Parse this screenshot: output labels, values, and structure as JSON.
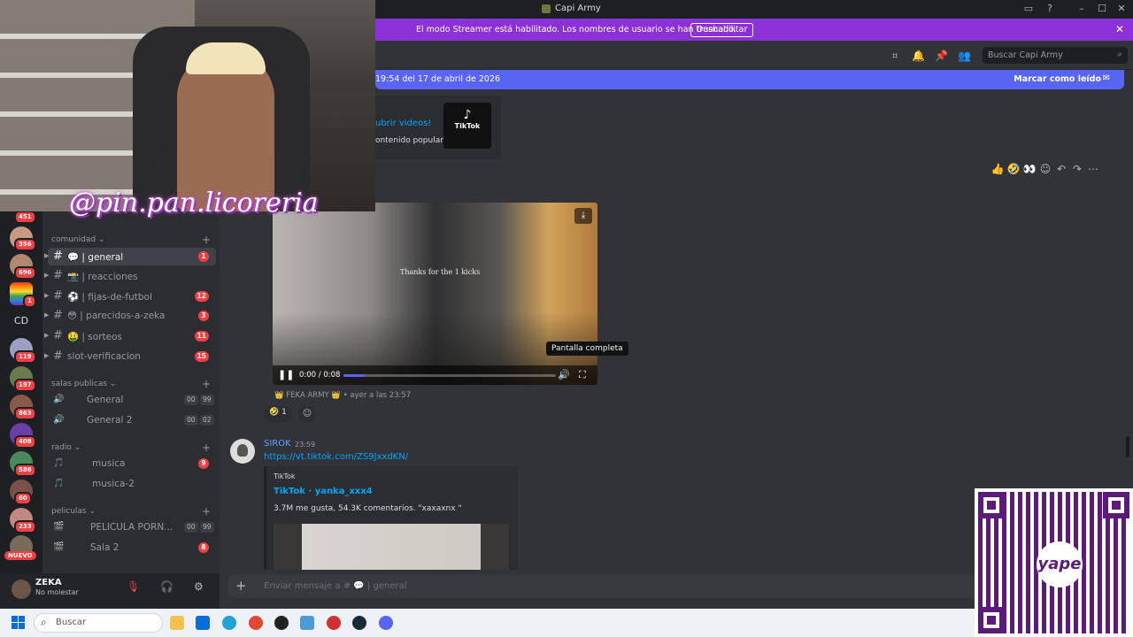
{
  "window": {
    "title": "Capi Army"
  },
  "banner": {
    "text": "El modo Streamer está habilitado. Los nombres de usuario se han truncado.",
    "button": "Deshabilitar"
  },
  "header": {
    "search_placeholder": "Buscar Capi Army"
  },
  "newbar": {
    "left": "19:54 del 17 de abril de 2026",
    "right": "Marcar como leído"
  },
  "embed_top": {
    "title": "ubrir videos!",
    "desc": "ontenido popular.",
    "logo": "TikTok"
  },
  "sidebar": {
    "categories": [
      {
        "name": "comunidad"
      },
      {
        "name": "salas publicas"
      },
      {
        "name": "radio"
      },
      {
        "name": "peliculas"
      }
    ],
    "channels": [
      {
        "name": "💬 | general",
        "badge": "1"
      },
      {
        "name": "📸 | reacciones",
        "badge": ""
      },
      {
        "name": "⚽ | fijas-de-futbol",
        "badge": "12"
      },
      {
        "name": "😳 | parecidos-a-zeka",
        "badge": "3"
      },
      {
        "name": "🤑 | sorteos",
        "badge": "11"
      },
      {
        "name": "slot-verificacion",
        "badge": "15"
      },
      {
        "name": "General",
        "p1": "00",
        "p2": "99"
      },
      {
        "name": "General 2",
        "p1": "00",
        "p2": "02"
      },
      {
        "name": "musica",
        "badge": "9"
      },
      {
        "name": "musica-2",
        "badge": ""
      },
      {
        "name": "PELICULA PORN...",
        "p1": "00",
        "p2": "99"
      },
      {
        "name": "Sala 2",
        "badge": "8"
      }
    ],
    "guild_badges": [
      "451",
      "356",
      "696",
      "1",
      "119",
      "197",
      "863",
      "408",
      "586",
      "60",
      "233"
    ],
    "guild_text": "CD",
    "nuevo": "NUEVO"
  },
  "user": {
    "name": "ZEKA",
    "status": "No molestar"
  },
  "video": {
    "time": "0:00 / 0:08",
    "caption": "Thanks for the 1 kicks",
    "tooltip": "Pantalla completa",
    "meta": "👑 FEKA ARMY 👑  •  ayer a las 23:57",
    "progress": 0.1
  },
  "reaction": {
    "emoji": "🤣",
    "count": "1"
  },
  "message2": {
    "author": "SIROK",
    "time": "23:59",
    "link": "https://vt.tiktok.com/ZS9JxxdKN/",
    "embed": {
      "provider": "TikTok",
      "title": "TikTok · yanka_xxx4",
      "desc": "3.7M me gusta, 54.3K comentarios. \"xaxaxnx \""
    }
  },
  "composer": {
    "placeholder": "Enviar mensaje a # 💬 | general"
  },
  "taskbar": {
    "search": "Buscar"
  },
  "overlay": {
    "watermark": "@pin.pan.licoreria",
    "qr_logo": "yape"
  },
  "colors": {
    "accent": "#5865f2",
    "streamer": "#8c31d8",
    "danger": "#f23f43"
  }
}
